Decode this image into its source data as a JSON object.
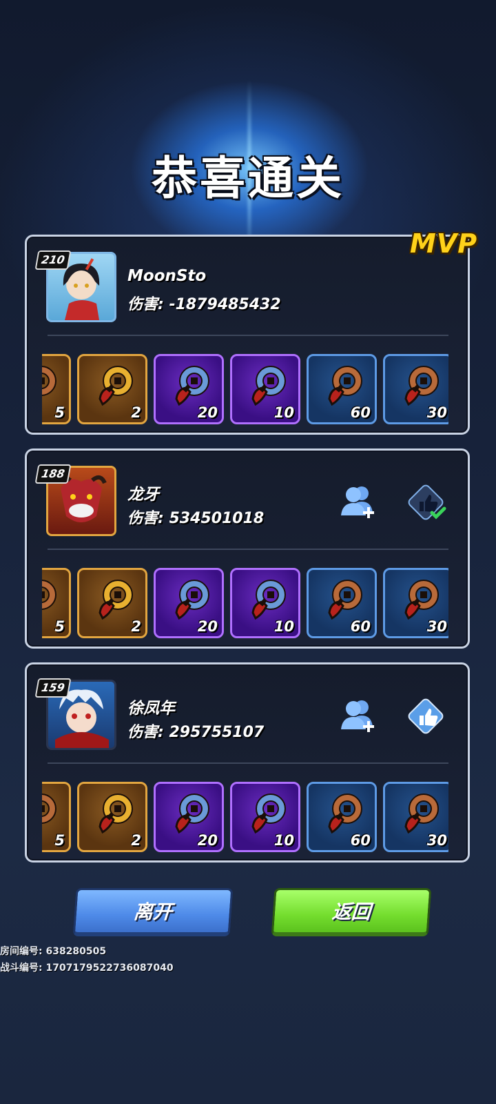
{
  "title": "恭喜通关",
  "mvp_label": "MVP",
  "damage_prefix": "伤害: ",
  "players": [
    {
      "level": "210",
      "name": "MoonSto",
      "damage": "伤害: -1879485432",
      "is_mvp": true
    },
    {
      "level": "188",
      "name": "龙牙",
      "damage": "伤害: 534501018",
      "is_mvp": false,
      "liked": true
    },
    {
      "level": "159",
      "name": "徐凤年",
      "damage": "伤害: 295755107",
      "is_mvp": false,
      "liked": false
    }
  ],
  "items": [
    {
      "rarity": "gold",
      "icon": "bronze-coin-scroll-icon",
      "count": "5"
    },
    {
      "rarity": "gold",
      "icon": "gold-coin-scroll-icon",
      "count": "2"
    },
    {
      "rarity": "purple",
      "icon": "blue-coin-scroll-icon",
      "count": "20"
    },
    {
      "rarity": "purple",
      "icon": "blue-coin-scroll-icon",
      "count": "10"
    },
    {
      "rarity": "blue",
      "icon": "bronze-coin-scroll-icon",
      "count": "60"
    },
    {
      "rarity": "blue",
      "icon": "bronze-coin-scroll-icon",
      "count": "30"
    }
  ],
  "buttons": {
    "leave": "离开",
    "back": "返回"
  },
  "room_id": "房间编号: 638280505",
  "battle_id": "战斗编号: 1707179522736087040",
  "colors": {
    "mvp": "#ffd21a",
    "leave_button": "#4e8ae8",
    "back_button": "#74dd2e",
    "card_border": "#c9d3e4"
  }
}
